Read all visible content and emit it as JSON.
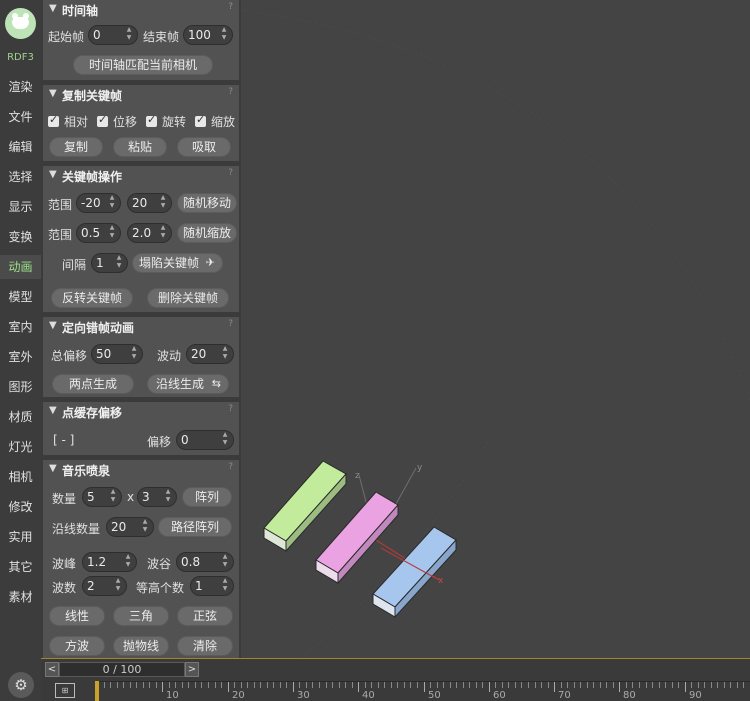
{
  "nav": {
    "brand": "RDF3",
    "items": [
      "渲染",
      "文件",
      "编辑",
      "选择",
      "显示",
      "变换",
      "动画",
      "模型",
      "室内",
      "室外",
      "图形",
      "材质",
      "灯光",
      "相机",
      "修改",
      "实用",
      "其它",
      "素材"
    ],
    "active_index": 6
  },
  "timeline_panel": {
    "title": "时间轴",
    "start_label": "起始帧",
    "start_value": "0",
    "end_label": "结束帧",
    "end_value": "100",
    "match_button": "时间轴匹配当前相机",
    "help": "?"
  },
  "copy_panel": {
    "title": "复制关键帧",
    "checks": [
      "相对",
      "位移",
      "旋转",
      "缩放"
    ],
    "buttons": [
      "复制",
      "粘贴",
      "吸取"
    ],
    "help": "?"
  },
  "keyops_panel": {
    "title": "关键帧操作",
    "range_label": "范围",
    "range1_min": "-20",
    "range1_max": "20",
    "random_move": "随机移动",
    "range2_min": "0.5",
    "range2_max": "2.0",
    "random_scale": "随机缩放",
    "interval_label": "间隔",
    "interval_value": "1",
    "collapse_button": "塌陷关键帧",
    "reverse_button": "反转关键帧",
    "delete_button": "删除关键帧",
    "help": "?"
  },
  "stagger_panel": {
    "title": "定向错帧动画",
    "offset_label": "总偏移",
    "offset_value": "50",
    "wave_label": "波动",
    "wave_value": "20",
    "two_point_button": "两点生成",
    "along_line_button": "沿线生成",
    "help": "?"
  },
  "pointcache_panel": {
    "title": "点缓存偏移",
    "target": "[ - ]",
    "offset_label": "偏移",
    "offset_value": "0",
    "help": "?"
  },
  "music_panel": {
    "title": "音乐喷泉",
    "count_label": "数量",
    "count_x": "5",
    "times": "x",
    "count_y": "3",
    "array_button": "阵列",
    "along_count_label": "沿线数量",
    "along_count_value": "20",
    "path_array_button": "路径阵列",
    "peak_label": "波峰",
    "peak_value": "1.2",
    "trough_label": "波谷",
    "trough_value": "0.8",
    "wave_count_label": "波数",
    "wave_count_value": "2",
    "height_count_label": "等高个数",
    "height_count_value": "1",
    "mode_buttons": [
      "线性",
      "三角",
      "正弦",
      "方波",
      "抛物线",
      "清除"
    ],
    "help": "?"
  },
  "timeline": {
    "position": "0 / 100",
    "prev": "<",
    "next": ">",
    "ruler_labels": [
      "10",
      "20",
      "30",
      "40",
      "50",
      "60",
      "70",
      "80",
      "90",
      "10"
    ],
    "current_frame": 0,
    "total_frames": 100
  },
  "viewport": {
    "axis_labels": [
      "z",
      "y",
      "x"
    ],
    "box_colors": [
      "#bfe8a0",
      "#e8a2e0",
      "#a2c4ec"
    ]
  },
  "colors": {
    "accent": "#9ee08b",
    "timeline_cursor": "#c9a227"
  }
}
